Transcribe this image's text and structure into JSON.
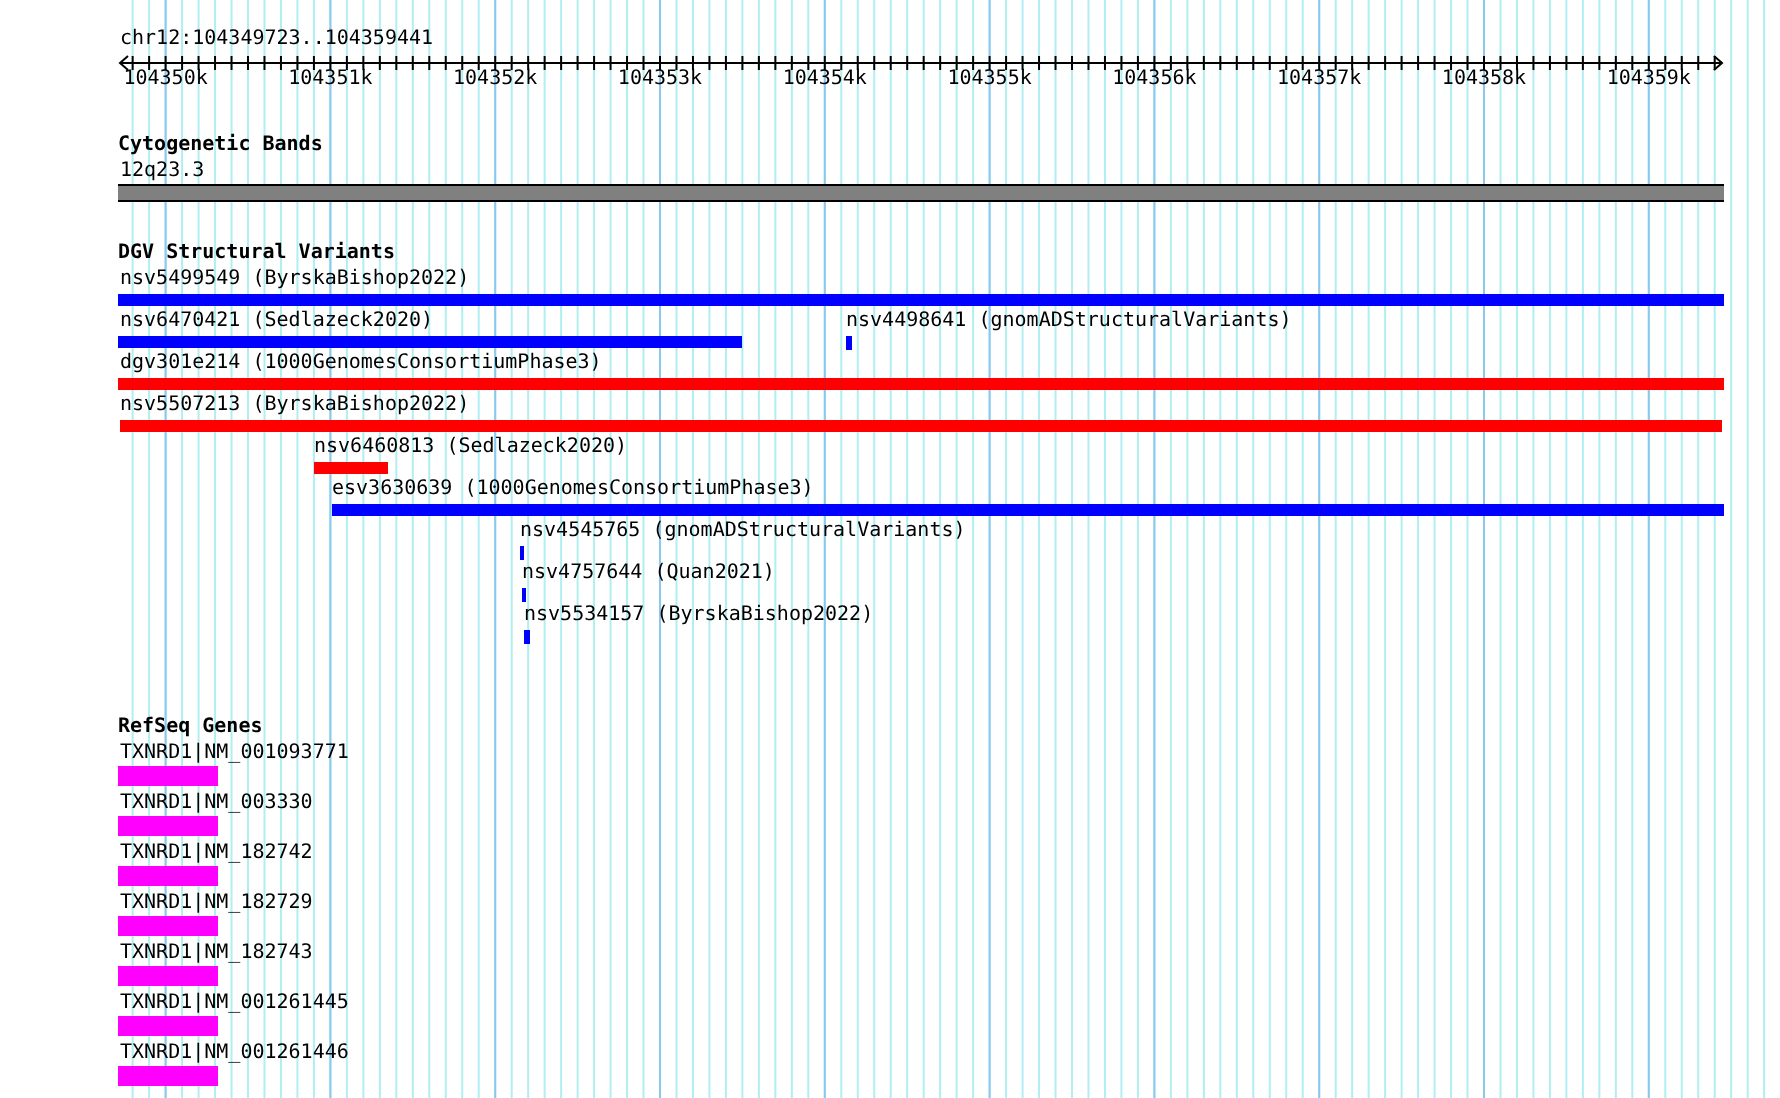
{
  "ruler": {
    "title": "chr12:104349723..104359441",
    "ticks": [
      "104350k",
      "104351k",
      "104352k",
      "104353k",
      "104354k",
      "104355k",
      "104356k",
      "104357k",
      "104358k",
      "104359k"
    ]
  },
  "tracks": [
    {
      "title": "Cytogenetic Bands",
      "kind": "bands",
      "features": [
        {
          "label": "12q23.3",
          "color": "#808080"
        }
      ]
    },
    {
      "title": "DGV Structural Variants",
      "kind": "variants",
      "features": [
        {
          "label": "nsv5499549 (ByrskaBishop2022)",
          "color": "#0000ff"
        },
        {
          "label": "nsv6470421 (Sedlazeck2020)",
          "color": "#0000ff"
        },
        {
          "label": "nsv4498641 (gnomADStructuralVariants)",
          "color": "#0000ff"
        },
        {
          "label": "dgv301e214 (1000GenomesConsortiumPhase3)",
          "color": "#ff0000"
        },
        {
          "label": "nsv5507213 (ByrskaBishop2022)",
          "color": "#ff0000"
        },
        {
          "label": "nsv6460813 (Sedlazeck2020)",
          "color": "#ff0000"
        },
        {
          "label": "esv3630639 (1000GenomesConsortiumPhase3)",
          "color": "#0000ff"
        },
        {
          "label": "nsv4545765 (gnomADStructuralVariants)",
          "color": "#0000ff"
        },
        {
          "label": "nsv4757644 (Quan2021)",
          "color": "#0000ff"
        },
        {
          "label": "nsv5534157 (ByrskaBishop2022)",
          "color": "#0000ff"
        }
      ]
    },
    {
      "title": "RefSeq Genes",
      "kind": "genes",
      "features": [
        {
          "label": "TXNRD1|NM_001093771",
          "color": "#ff00ff"
        },
        {
          "label": "TXNRD1|NM_003330",
          "color": "#ff00ff"
        },
        {
          "label": "TXNRD1|NM_182742",
          "color": "#ff00ff"
        },
        {
          "label": "TXNRD1|NM_182729",
          "color": "#ff00ff"
        },
        {
          "label": "TXNRD1|NM_182743",
          "color": "#ff00ff"
        },
        {
          "label": "TXNRD1|NM_001261445",
          "color": "#ff00ff"
        },
        {
          "label": "TXNRD1|NM_001261446",
          "color": "#ff00ff"
        }
      ]
    }
  ]
}
